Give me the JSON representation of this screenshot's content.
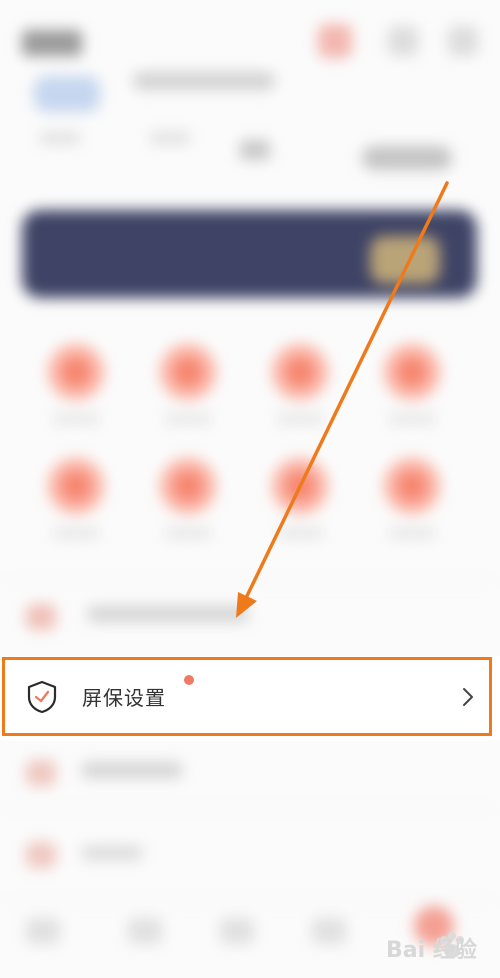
{
  "settings_row": {
    "label": "屏保设置",
    "has_new_dot": true,
    "icon": "shield-check-icon",
    "chevron": "chevron-right-icon"
  },
  "annotation": {
    "arrow_color": "#ee7a1c",
    "frame_color": "#ee7a1c"
  },
  "watermark": {
    "text": "Bai 经验"
  },
  "colors": {
    "accent": "#ef7a63",
    "banner": "#3f4466"
  }
}
